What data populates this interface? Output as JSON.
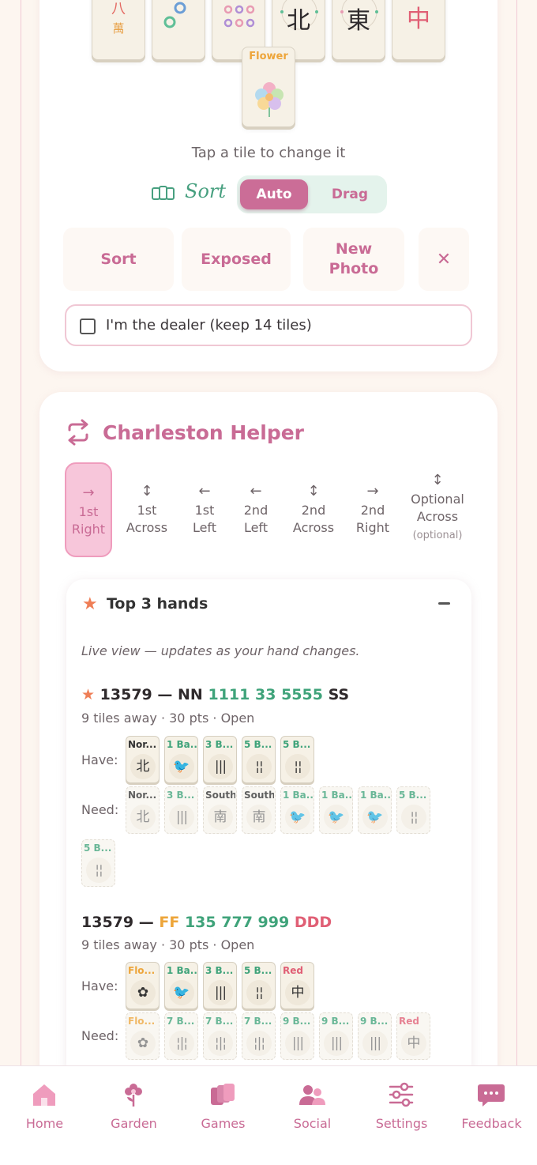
{
  "hand_tiles": [
    {
      "name": "character-eight",
      "glyph": "八",
      "sub": "萬"
    },
    {
      "name": "dot-two"
    },
    {
      "name": "dot-six"
    },
    {
      "name": "north-wind",
      "glyph": "北"
    },
    {
      "name": "east-wind",
      "glyph": "東"
    },
    {
      "name": "red-dragon",
      "glyph": "中"
    }
  ],
  "flower_tile": {
    "label": "Flower"
  },
  "tile_hint": "Tap a tile to change it",
  "sort_toggle": {
    "label": "Sort",
    "auto": "Auto",
    "drag": "Drag",
    "selected": "Auto"
  },
  "actions": {
    "sort": "Sort",
    "exposed": "Exposed",
    "new_photo_1": "New",
    "new_photo_2": "Photo",
    "close": "✕"
  },
  "dealer": {
    "label": "I'm the dealer (keep 14 tiles)",
    "checked": false
  },
  "charleston": {
    "title": "Charleston Helper",
    "passes": [
      {
        "arrow": "→",
        "l1": "1st",
        "l2": "Right",
        "active": true
      },
      {
        "arrow": "↕",
        "l1": "1st",
        "l2": "Across"
      },
      {
        "arrow": "←",
        "l1": "1st",
        "l2": "Left"
      },
      {
        "arrow": "←",
        "l1": "2nd",
        "l2": "Left"
      },
      {
        "arrow": "↕",
        "l1": "2nd",
        "l2": "Across"
      },
      {
        "arrow": "→",
        "l1": "2nd",
        "l2": "Right"
      },
      {
        "arrow": "↕",
        "l1": "Optional",
        "l2": "Across",
        "note": "(optional)"
      }
    ]
  },
  "top_hands": {
    "title": "Top 3 hands",
    "collapse": "−",
    "live_note": "Live view — updates as your hand changes.",
    "hands": [
      {
        "year": "13579",
        "dash": "—",
        "pattern": [
          {
            "t": "NN",
            "c": ""
          },
          {
            "t": "1111",
            "c": "g"
          },
          {
            "t": "33",
            "c": "g"
          },
          {
            "t": "5555",
            "c": "g"
          },
          {
            "t": "SS",
            "c": ""
          }
        ],
        "meta": "9 tiles away · 30 pts · Open",
        "have_label": "Have:",
        "need_label": "Need:",
        "have": [
          "Nor...",
          "1 Ba...",
          "3 B...",
          "5 B...",
          "5 B..."
        ],
        "need": [
          "Nor...",
          "3 B...",
          "South",
          "South",
          "1 Ba...",
          "1 Ba...",
          "1 Ba...",
          "5 B...",
          "5 B..."
        ]
      },
      {
        "year": "13579",
        "dash": "—",
        "pattern": [
          {
            "t": "FF",
            "c": "o"
          },
          {
            "t": "135",
            "c": "g"
          },
          {
            "t": "777",
            "c": "g"
          },
          {
            "t": "999",
            "c": "g"
          },
          {
            "t": "DDD",
            "c": "r"
          }
        ],
        "meta": "9 tiles away · 30 pts · Open",
        "have_label": "Have:",
        "need_label": "Need:",
        "have": [
          "Flo...",
          "1 Ba...",
          "3 B...",
          "5 B...",
          "Red"
        ],
        "need": [
          "Flo...",
          "7 B...",
          "7 B...",
          "7 B...",
          "9 B...",
          "9 B...",
          "9 B...",
          "Red"
        ]
      }
    ]
  },
  "nav": [
    {
      "label": "Home",
      "icon": "home-icon"
    },
    {
      "label": "Garden",
      "icon": "flower-icon"
    },
    {
      "label": "Games",
      "icon": "cards-icon"
    },
    {
      "label": "Social",
      "icon": "people-icon"
    },
    {
      "label": "Settings",
      "icon": "sliders-icon"
    },
    {
      "label": "Feedback",
      "icon": "chat-icon"
    }
  ]
}
